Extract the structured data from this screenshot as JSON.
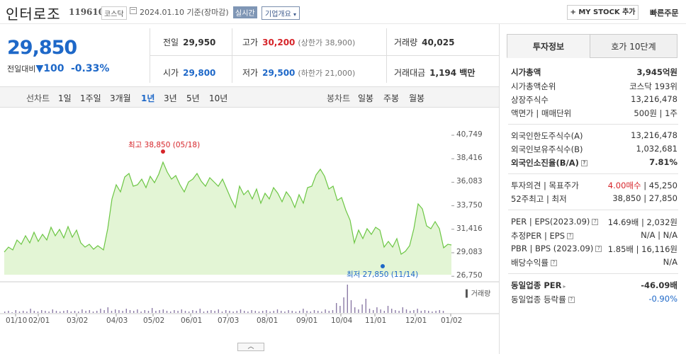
{
  "header": {
    "name": "인터로조",
    "code": "119610",
    "market": "코스닥",
    "date": "2024.01.10",
    "basis": "기준(장마감)",
    "realtime": "실시간",
    "company_overview": "기업개요",
    "mystock": "+ MY STOCK 추가",
    "quick_order": "빠른주문"
  },
  "price": {
    "current": "29,850",
    "change_label": "전일대비",
    "change_arrow": "▼",
    "change": "100",
    "change_pct": "-0.33%"
  },
  "info": {
    "prev_label": "전일",
    "prev": "29,950",
    "high_label": "고가",
    "high": "30,200",
    "upper_limit": "(상한가 38,900)",
    "volume_label": "거래량",
    "volume": "40,025",
    "open_label": "시가",
    "open": "29,800",
    "low_label": "저가",
    "low": "29,500",
    "lower_limit": "(하한가 21,000)",
    "amount_label": "거래대금",
    "amount": "1,194 백만"
  },
  "tabs": {
    "line_chart": "선차트",
    "d1": "1일",
    "w1": "1주일",
    "m3": "3개월",
    "y1": "1년",
    "y3": "3년",
    "y5": "5년",
    "y10": "10년",
    "candle_chart": "봉차트",
    "daily": "일봉",
    "weekly": "주봉",
    "monthly": "월봉"
  },
  "chart": {
    "high_label": "최고 38,850 (05/18)",
    "low_label": "최저 27,850 (11/14)",
    "volume_label": "거래량",
    "y_ticks": [
      "40,749",
      "38,416",
      "36,083",
      "33,750",
      "31,416",
      "29,083",
      "26,750"
    ],
    "x_ticks": [
      "01/10",
      "02/01",
      "03/02",
      "04/03",
      "05/02",
      "06/01",
      "07/03",
      "08/01",
      "09/01",
      "10/04",
      "11/01",
      "12/01",
      "01/02"
    ],
    "line_color": "#6cc644",
    "fill_color": "#e3f5d5",
    "high_color": "#d6252a",
    "low_color": "#1e68c8"
  },
  "right": {
    "tab_active": "투자정보",
    "tab_other": "호가 10단계",
    "market_cap_label": "시가총액",
    "market_cap": "3,945억원",
    "rank_label": "시가총액순위",
    "rank": "코스닥 193위",
    "shares_label": "상장주식수",
    "shares": "13,216,478",
    "par_label": "액면가 | 매매단위",
    "par": "500원 | 1주",
    "foreign_limit_label": "외국인한도주식수(A)",
    "foreign_limit": "13,216,478",
    "foreign_hold_label": "외국인보유주식수(B)",
    "foreign_hold": "1,032,681",
    "foreign_ratio_label": "외국인소진율(B/A)",
    "foreign_ratio": "7.81%",
    "opinion_label": "투자의견 | 목표주가",
    "opinion": "4.00매수",
    "target": "| 45,250",
    "w52_label": "52주최고 | 최저",
    "w52": "38,850 | 27,850",
    "per_label": "PER | EPS(2023.09)",
    "per": "14.69배 | 2,032원",
    "est_per_label": "추정PER | EPS",
    "est_per": "N/A | N/A",
    "pbr_label": "PBR | BPS (2023.09)",
    "pbr": "1.85배 | 16,116원",
    "div_label": "배당수익률",
    "div": "N/A",
    "ind_per_label": "동일업종 PER",
    "ind_per": "-46.09배",
    "ind_rate_label": "동일업종 등락률",
    "ind_rate": "-0.90%"
  }
}
